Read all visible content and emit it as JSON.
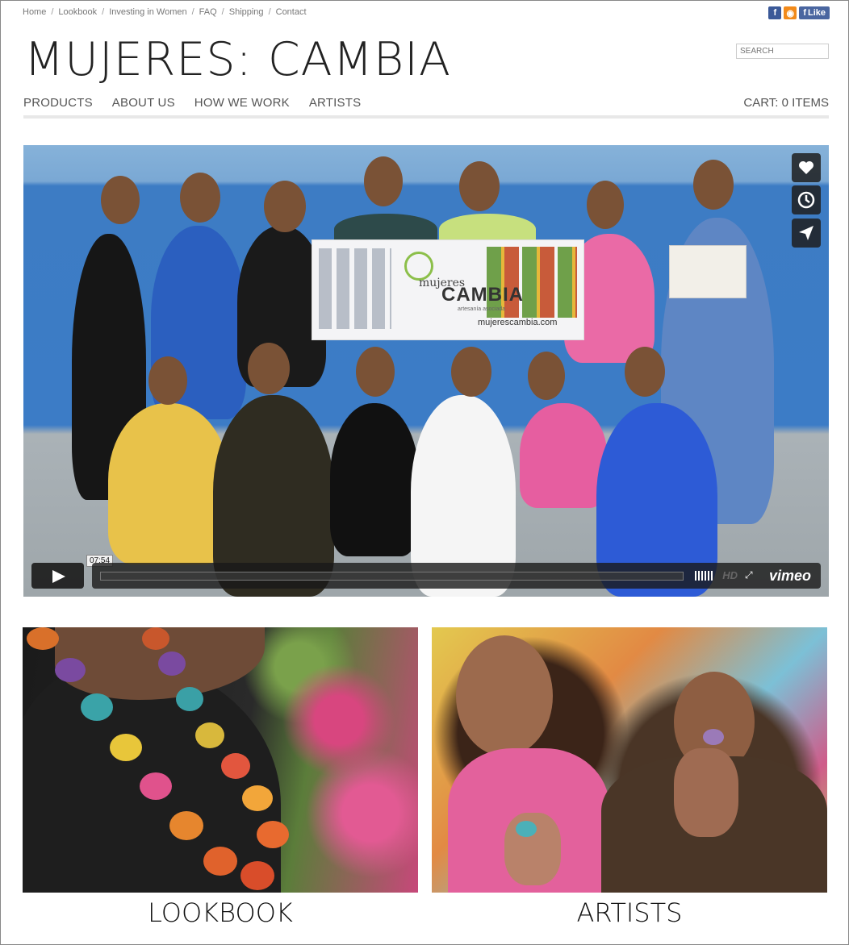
{
  "topnav": {
    "links": [
      "Home",
      "Lookbook",
      "Investing in Women",
      "FAQ",
      "Shipping",
      "Contact"
    ],
    "separator": "/"
  },
  "social": {
    "facebook_glyph": "f",
    "rss_glyph": "◉",
    "like_label": "Like"
  },
  "header": {
    "logo": "MUJERES: CAMBIA",
    "search_placeholder": "SEARCH"
  },
  "mainnav": {
    "items": [
      "PRODUCTS",
      "ABOUT US",
      "HOW WE WORK",
      "ARTISTS"
    ],
    "cart": "CART: 0 ITEMS"
  },
  "video": {
    "banner": {
      "line1": "mujeres",
      "line2": "CAMBIA",
      "line3": "artesanía asociada",
      "line4": "mujerescambia.com"
    },
    "time": "07:54",
    "hd": "HD",
    "brand": "vimeo",
    "side_icons": [
      "heart-icon",
      "clock-icon",
      "send-icon"
    ],
    "progress": 0
  },
  "tiles": [
    {
      "label": "LOOKBOOK"
    },
    {
      "label": "ARTISTS"
    }
  ]
}
